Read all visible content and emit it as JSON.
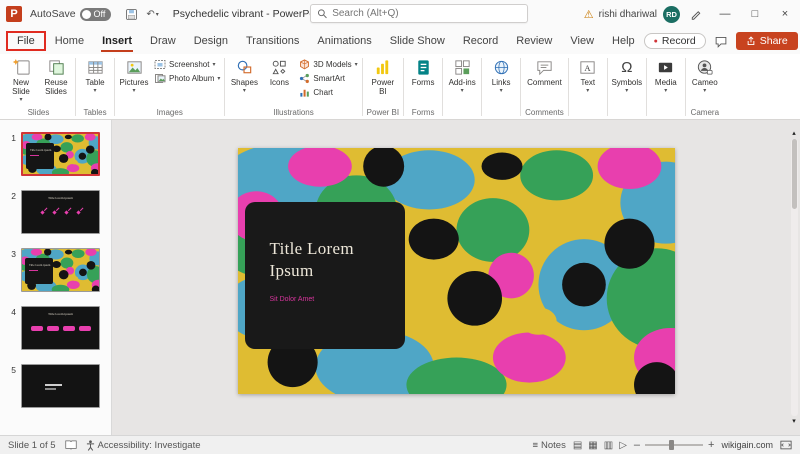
{
  "icons": {
    "dropdown": "▾",
    "minimize": "—",
    "maximize": "□",
    "close": "×",
    "warning": "⚠",
    "undo": "↶",
    "record_dot": "●",
    "notes": "≡",
    "view_normal": "▤",
    "view_sorter": "▦",
    "view_reading": "▥",
    "view_slideshow": "▷",
    "zoom_minus": "–",
    "zoom_plus": "+",
    "scroll_up": "▴",
    "scroll_down": "▾",
    "omega": "Ω",
    "app_logo": "P"
  },
  "title_bar": {
    "autosave_label": "AutoSave",
    "autosave_state": "Off",
    "title": "Psychedelic vibrant - PowerPoint",
    "search_placeholder": "Search (Alt+Q)",
    "user_name": "rishi dhariwal",
    "user_initials": "RD"
  },
  "tab_row": {
    "tabs": [
      "File",
      "Home",
      "Insert",
      "Draw",
      "Design",
      "Transitions",
      "Animations",
      "Slide Show",
      "Record",
      "Review",
      "View",
      "Help"
    ],
    "active_tab": "Insert",
    "highlighted_tab": "File",
    "record_label": "Record",
    "share_label": "Share"
  },
  "ribbon": {
    "groups": [
      {
        "label": "Slides",
        "items": [
          {
            "label": "New Slide"
          },
          {
            "label": "Reuse Slides"
          }
        ]
      },
      {
        "label": "Tables",
        "items": [
          {
            "label": "Table"
          }
        ]
      },
      {
        "label": "Images",
        "items": [
          {
            "label": "Pictures"
          },
          {
            "label": "Screenshot"
          },
          {
            "label": "Photo Album"
          }
        ]
      },
      {
        "label": "Illustrations",
        "items": [
          {
            "label": "Shapes"
          },
          {
            "label": "Icons"
          },
          {
            "label": "3D Models"
          },
          {
            "label": "SmartArt"
          },
          {
            "label": "Chart"
          }
        ]
      },
      {
        "label": "Power BI",
        "items": [
          {
            "label": "Power BI"
          }
        ]
      },
      {
        "label": "Forms",
        "items": [
          {
            "label": "Forms"
          }
        ]
      },
      {
        "label": "",
        "items": [
          {
            "label": "Add-ins"
          }
        ]
      },
      {
        "label": "",
        "items": [
          {
            "label": "Links"
          }
        ]
      },
      {
        "label": "Comments",
        "items": [
          {
            "label": "Comment"
          }
        ]
      },
      {
        "label": "",
        "items": [
          {
            "label": "Text"
          }
        ]
      },
      {
        "label": "",
        "items": [
          {
            "label": "Symbols"
          }
        ]
      },
      {
        "label": "",
        "items": [
          {
            "label": "Media"
          }
        ]
      },
      {
        "label": "Camera",
        "items": [
          {
            "label": "Cameo"
          }
        ]
      }
    ]
  },
  "slides_panel": {
    "thumbnails": [
      {
        "number": "1",
        "title_text": "Title lorem ipsum",
        "selected": true
      },
      {
        "number": "2",
        "title_text": "Title lorem ipsum",
        "selected": false
      },
      {
        "number": "3",
        "title_text": "Title lorem ipsum",
        "selected": false
      },
      {
        "number": "4",
        "title_text": "Title lorem ipsum",
        "selected": false
      },
      {
        "number": "5",
        "title_text": "",
        "selected": false
      }
    ]
  },
  "slide": {
    "title": "Title Lorem Ipsum",
    "subtitle": "Sit Dolor Amet"
  },
  "status_bar": {
    "slide_indicator": "Slide 1 of 5",
    "accessibility": "Accessibility: Investigate",
    "notes_label": "Notes",
    "watermark": "wikigain.com"
  },
  "colors": {
    "accent": "#c43e1c",
    "share_button": "#c8431f",
    "selection_border": "#d13438",
    "art_yellow": "#dfbc32",
    "art_blue": "#4fa6c6",
    "art_green": "#36a158",
    "art_pink": "#e83fae",
    "art_black": "#141414"
  }
}
